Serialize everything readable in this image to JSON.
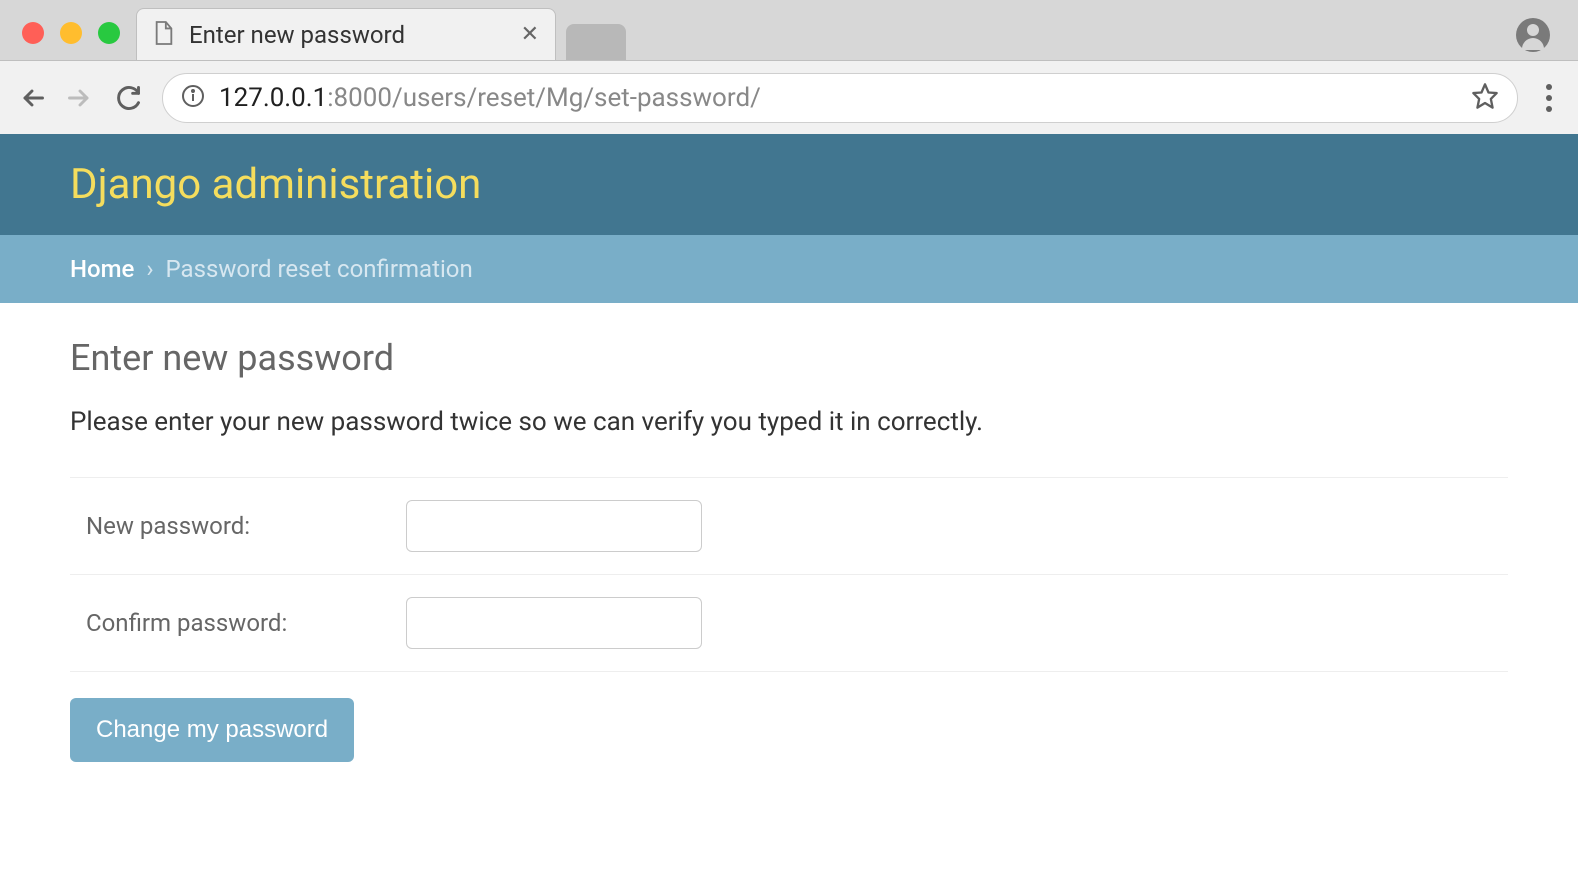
{
  "browser": {
    "tab_title": "Enter new password",
    "url_host": "127.0.0.1",
    "url_port_path": ":8000/users/reset/Mg/set-password/"
  },
  "header": {
    "title": "Django administration"
  },
  "breadcrumb": {
    "home_label": "Home",
    "separator": "›",
    "current": "Password reset confirmation"
  },
  "page": {
    "title": "Enter new password",
    "instruction": "Please enter your new password twice so we can verify you typed it in correctly."
  },
  "form": {
    "new_password_label": "New password:",
    "confirm_password_label": "Confirm password:",
    "submit_label": "Change my password"
  }
}
